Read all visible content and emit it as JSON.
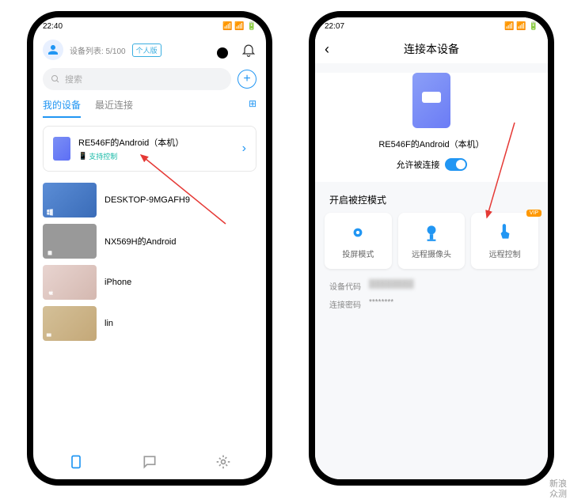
{
  "s1": {
    "time": "22:40"
  },
  "s2": {
    "time": "22:07"
  },
  "header": {
    "device_count": "设备列表: 5/100",
    "plan": "个人版"
  },
  "search": {
    "placeholder": "搜索"
  },
  "tabs": {
    "mine": "我的设备",
    "recent": "最近连接"
  },
  "primary_device": {
    "name": "RE546F的Android（本机）",
    "sub": "支持控制"
  },
  "devices": [
    {
      "name": "DESKTOP-9MGAFH9"
    },
    {
      "name": "NX569H的Android"
    },
    {
      "name": "iPhone"
    },
    {
      "name": "lin"
    }
  ],
  "p2": {
    "title": "连接本设备",
    "name": "RE546F的Android（本机）",
    "allow": "允许被连接",
    "section": "开启被控模式",
    "modes": [
      {
        "label": "投屏模式"
      },
      {
        "label": "远程摄像头"
      },
      {
        "label": "远程控制",
        "vip": "VIP"
      }
    ],
    "code_label": "设备代码",
    "code": "████████",
    "pass_label": "连接密码",
    "pass": "********"
  },
  "watermark": {
    "l1": "新浪",
    "l2": "众测"
  }
}
